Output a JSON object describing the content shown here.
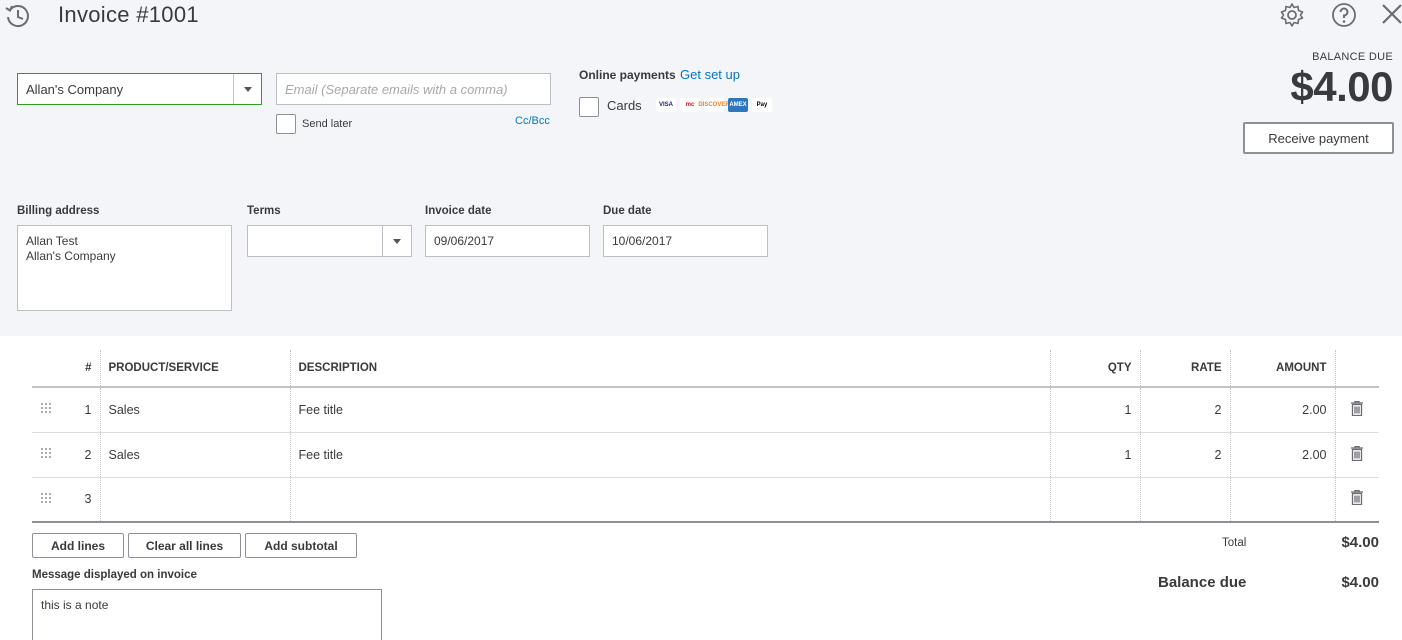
{
  "header": {
    "title": "Invoice #1001"
  },
  "customer": {
    "selected": "Allan's Company"
  },
  "email": {
    "placeholder": "Email (Separate emails with a comma)",
    "value": "",
    "send_later_label": "Send later",
    "send_later_checked": false,
    "cc_bcc_label": "Cc/Bcc"
  },
  "online_payments": {
    "label": "Online payments",
    "link": "Get set up",
    "cards_label": "Cards",
    "cards_checked": false,
    "card_logos": [
      {
        "name": "VISA",
        "bg": "#ffffff",
        "fg": "#1a1f71"
      },
      {
        "name": "mc",
        "bg": "#ffffff",
        "fg": "#eb001b"
      },
      {
        "name": "DISCOVER",
        "bg": "#ffffff",
        "fg": "#f58220"
      },
      {
        "name": "AMEX",
        "bg": "#2e77bc",
        "fg": "#ffffff"
      },
      {
        "name": "Pay",
        "bg": "#ffffff",
        "fg": "#000000"
      }
    ]
  },
  "balance": {
    "label": "BALANCE DUE",
    "amount": "$4.00",
    "receive_button": "Receive payment"
  },
  "billing": {
    "label": "Billing address",
    "line1": "Allan Test",
    "line2": "Allan's Company"
  },
  "terms": {
    "label": "Terms",
    "value": ""
  },
  "invoice_date": {
    "label": "Invoice date",
    "value": "09/06/2017"
  },
  "due_date": {
    "label": "Due date",
    "value": "10/06/2017"
  },
  "table": {
    "columns": [
      "#",
      "PRODUCT/SERVICE",
      "DESCRIPTION",
      "QTY",
      "RATE",
      "AMOUNT"
    ],
    "rows": [
      {
        "num": "1",
        "product": "Sales",
        "description": "Fee title",
        "qty": "1",
        "rate": "2",
        "amount": "2.00"
      },
      {
        "num": "2",
        "product": "Sales",
        "description": "Fee title",
        "qty": "1",
        "rate": "2",
        "amount": "2.00"
      },
      {
        "num": "3",
        "product": "",
        "description": "",
        "qty": "",
        "rate": "",
        "amount": ""
      }
    ]
  },
  "actions": {
    "add_lines": "Add lines",
    "clear_all_lines": "Clear all lines",
    "add_subtotal": "Add subtotal"
  },
  "message": {
    "label": "Message displayed on invoice",
    "value": "this is a note"
  },
  "totals": {
    "total_label": "Total",
    "total_value": "$4.00",
    "balance_due_label": "Balance due",
    "balance_due_value": "$4.00"
  },
  "colors": {
    "accent_green": "#2ca01c",
    "link_blue": "#0077c5",
    "header_bg": "#f4f5f8",
    "text": "#393a3d"
  }
}
